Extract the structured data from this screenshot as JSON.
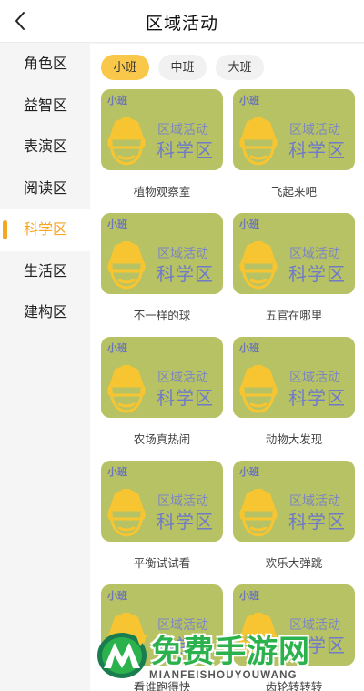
{
  "header": {
    "title": "区域活动",
    "back_icon": "chevron-left-icon"
  },
  "sidebar": {
    "items": [
      {
        "label": "角色区"
      },
      {
        "label": "益智区"
      },
      {
        "label": "表演区"
      },
      {
        "label": "阅读区"
      },
      {
        "label": "科学区",
        "active": true
      },
      {
        "label": "生活区"
      },
      {
        "label": "建构区"
      }
    ]
  },
  "tabs": [
    {
      "label": "小班",
      "active": true
    },
    {
      "label": "中班"
    },
    {
      "label": "大班"
    }
  ],
  "cards": [
    {
      "badge": "小班",
      "subtitle": "区域活动",
      "category": "科学区",
      "title": "植物观察室"
    },
    {
      "badge": "小班",
      "subtitle": "区域活动",
      "category": "科学区",
      "title": "飞起来吧"
    },
    {
      "badge": "小班",
      "subtitle": "区域活动",
      "category": "科学区",
      "title": "不一样的球"
    },
    {
      "badge": "小班",
      "subtitle": "区域活动",
      "category": "科学区",
      "title": "五官在哪里"
    },
    {
      "badge": "小班",
      "subtitle": "区域活动",
      "category": "科学区",
      "title": "农场真热闹"
    },
    {
      "badge": "小班",
      "subtitle": "区域活动",
      "category": "科学区",
      "title": "动物大发现"
    },
    {
      "badge": "小班",
      "subtitle": "区域活动",
      "category": "科学区",
      "title": "平衡试试看"
    },
    {
      "badge": "小班",
      "subtitle": "区域活动",
      "category": "科学区",
      "title": "欢乐大弹跳"
    },
    {
      "badge": "小班",
      "subtitle": "区域活动",
      "category": "科学区",
      "title": "看谁跑得快"
    },
    {
      "badge": "小班",
      "subtitle": "区域活动",
      "category": "科学区",
      "title": "齿轮转转转"
    }
  ],
  "watermark": {
    "text": "免费手游网",
    "pinyin": "MIANFEISHOUYOUWANG"
  },
  "colors": {
    "accent": "#f5a623",
    "tab_active": "#f9c84a",
    "card_bg": "#b7c264",
    "card_text": "#6f7bc8",
    "face_yellow": "#f7c531",
    "watermark_green": "#2bb24c"
  }
}
